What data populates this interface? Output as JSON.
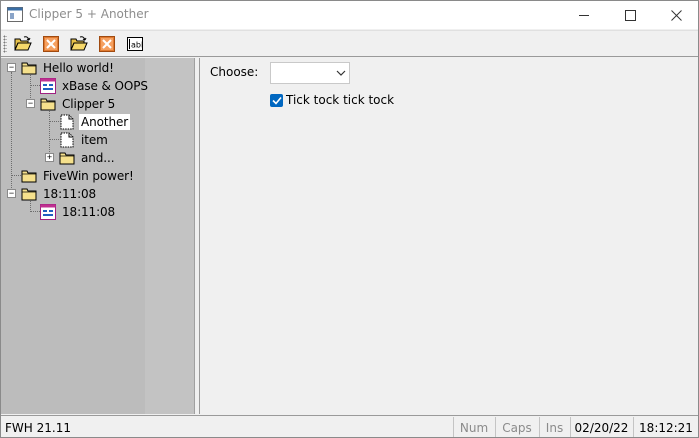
{
  "window": {
    "title": "Clipper 5 + Another"
  },
  "titlebar_buttons": {
    "minimize": "minimize",
    "maximize": "maximize",
    "close": "close"
  },
  "toolbar": {
    "buttons": [
      {
        "icon": "open-folder-icon"
      },
      {
        "icon": "close-box-icon"
      },
      {
        "icon": "open-folder-icon"
      },
      {
        "icon": "close-box-icon"
      },
      {
        "icon": "edit-field-icon"
      }
    ]
  },
  "tree": {
    "nodes": [
      {
        "label": "Hello world!",
        "icon": "folder-icon",
        "expander": "−"
      },
      {
        "label": "xBase & OOPS",
        "icon": "form-icon"
      },
      {
        "label": "Clipper 5",
        "icon": "folder-icon",
        "expander": "−"
      },
      {
        "label": "Another",
        "icon": "document-icon",
        "selected": true
      },
      {
        "label": "item",
        "icon": "document-icon"
      },
      {
        "label": "and...",
        "icon": "folder-icon",
        "expander": "+"
      },
      {
        "label": "FiveWin power!",
        "icon": "folder-icon"
      },
      {
        "label": "18:11:08",
        "icon": "folder-icon",
        "expander": "−"
      },
      {
        "label": "18:11:08",
        "icon": "form-icon"
      }
    ]
  },
  "form": {
    "choose_label": "Choose:",
    "combo_value": "",
    "checkbox_label": "Tick tock tick tock",
    "checkbox_checked": true
  },
  "statusbar": {
    "app": "FWH 21.11",
    "num": "Num",
    "caps": "Caps",
    "ins": "Ins",
    "date": "02/20/22",
    "time": "18:12:21"
  },
  "colors": {
    "accent": "#0067c0",
    "tree_bg": "#bcbcbc",
    "window_bg": "#f0f0f0"
  }
}
